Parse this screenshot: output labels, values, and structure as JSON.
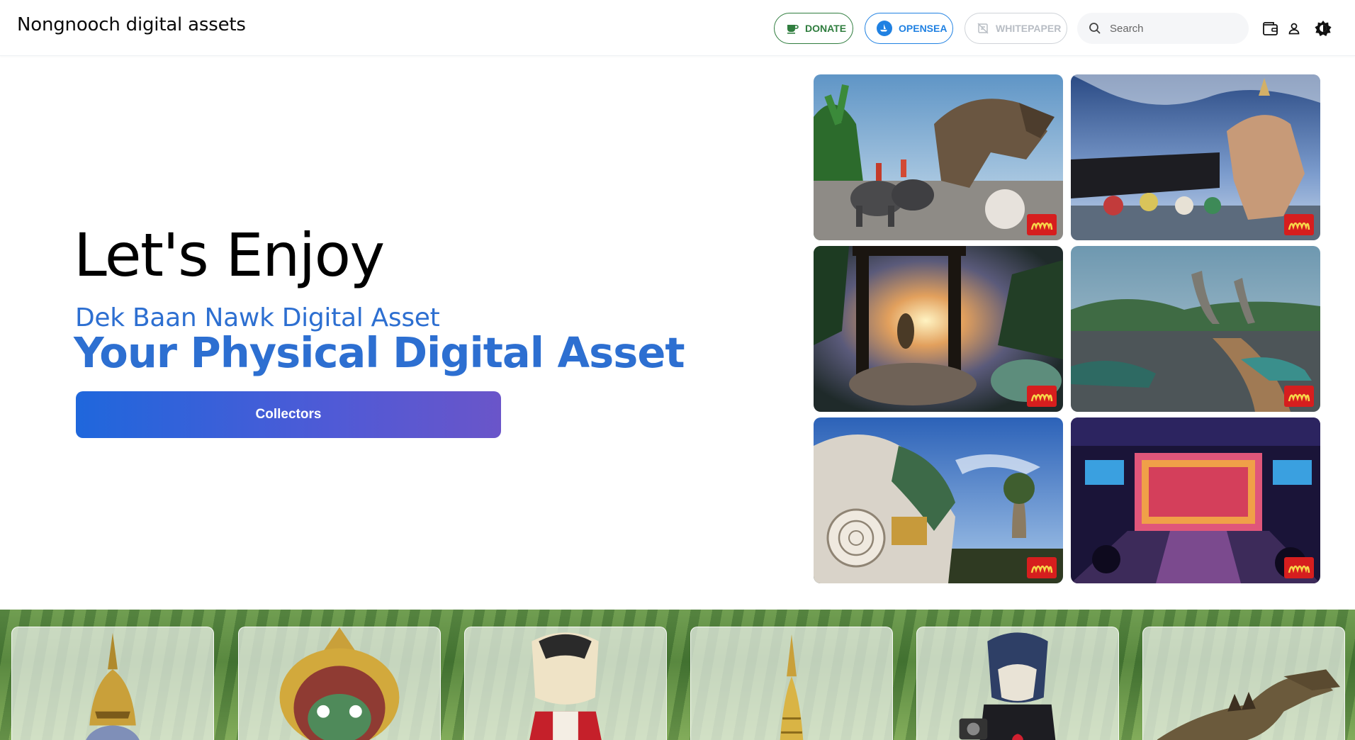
{
  "header": {
    "brand": "Nongnooch digital assets",
    "buttons": {
      "donate": "DONATE",
      "opensea": "OPENSEA",
      "whitepaper": "WHITEPAPER"
    },
    "search": {
      "placeholder": "Search"
    },
    "icons": [
      "wallet-icon",
      "user-icon",
      "theme-toggle-icon"
    ]
  },
  "hero": {
    "title": "Let's Enjoy",
    "subtitle": "Dek Baan Nawk Digital Asset",
    "tagline": "Your Physical Digital Asset",
    "cta": "Collectors"
  },
  "gallery": {
    "tiles": [
      "dinosaur-elephant-photo",
      "elephant-statue-photo",
      "sunset-garden-photo",
      "dinosaur-valley-photo",
      "giant-statue-photo",
      "theater-stage-photo"
    ]
  },
  "collection": {
    "cards": [
      "golden-crown-figure",
      "khon-mask-figure",
      "mascot-red-cape-figure",
      "golden-spire-figure",
      "mascot-camera-figure",
      "dinosaur-figure"
    ]
  },
  "colors": {
    "accent_blue": "#2d6fd1",
    "donate_green": "#2f7d3e",
    "opensea_blue": "#2081e2",
    "cta_gradient_start": "#1f67dc",
    "cta_gradient_end": "#6a55c9",
    "logo_red": "#d61e1e"
  }
}
